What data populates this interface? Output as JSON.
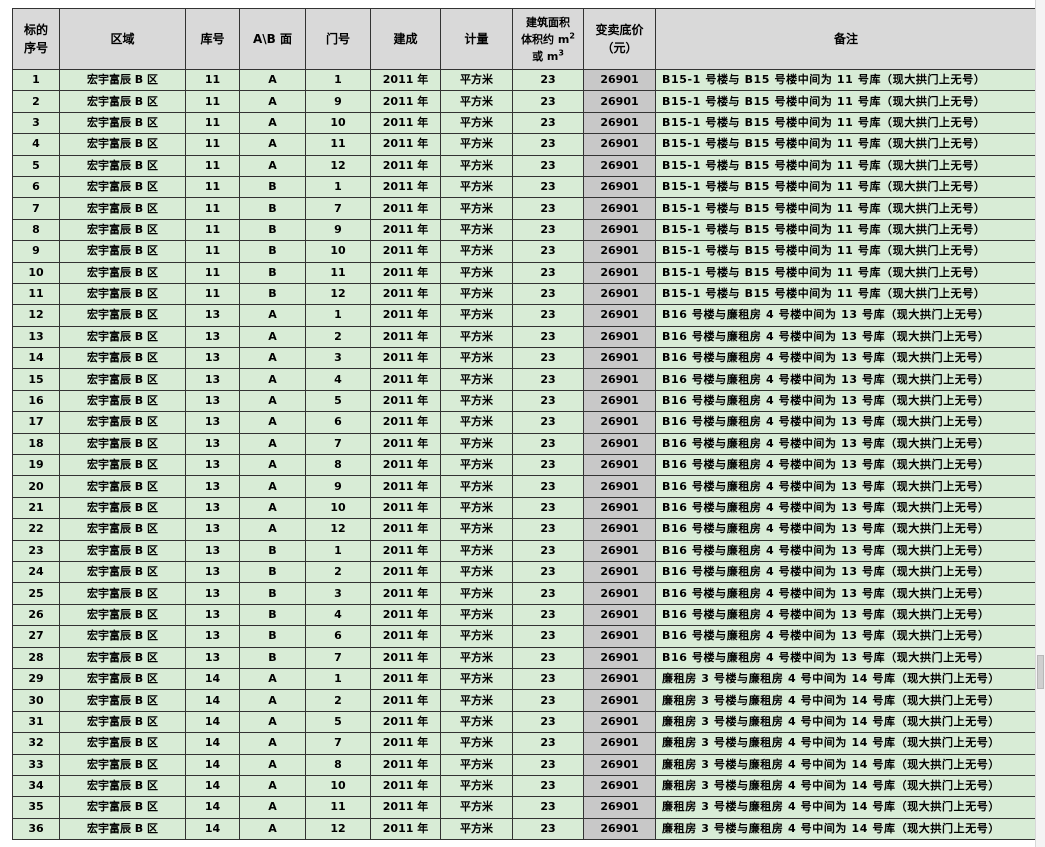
{
  "columns": {
    "seq_line1": "标的",
    "seq_line2": "序号",
    "area": "区域",
    "lot": "库号",
    "side": "A\\B 面",
    "door": "门号",
    "built": "建成",
    "unit": "计量",
    "size_line1": "建筑面积",
    "size_line2": "体积约 m",
    "size_sup1": "2",
    "size_line3": "或 m",
    "size_sup2": "3",
    "price_line1": "变卖底价",
    "price_line2": "（元）",
    "note": "备注"
  },
  "rows": [
    {
      "seq": "1",
      "area": "宏宇富辰 B 区",
      "lot": "11",
      "side": "A",
      "door": "1",
      "built": "2011 年",
      "unit": "平方米",
      "size": "23",
      "price": "26901",
      "note": "B15-1 号楼与 B15 号楼中间为 11 号库（现大拱门上无号）"
    },
    {
      "seq": "2",
      "area": "宏宇富辰 B 区",
      "lot": "11",
      "side": "A",
      "door": "9",
      "built": "2011 年",
      "unit": "平方米",
      "size": "23",
      "price": "26901",
      "note": "B15-1 号楼与 B15 号楼中间为 11 号库（现大拱门上无号）"
    },
    {
      "seq": "3",
      "area": "宏宇富辰 B 区",
      "lot": "11",
      "side": "A",
      "door": "10",
      "built": "2011 年",
      "unit": "平方米",
      "size": "23",
      "price": "26901",
      "note": "B15-1 号楼与 B15 号楼中间为 11 号库（现大拱门上无号）"
    },
    {
      "seq": "4",
      "area": "宏宇富辰 B 区",
      "lot": "11",
      "side": "A",
      "door": "11",
      "built": "2011 年",
      "unit": "平方米",
      "size": "23",
      "price": "26901",
      "note": "B15-1 号楼与 B15 号楼中间为 11 号库（现大拱门上无号）"
    },
    {
      "seq": "5",
      "area": "宏宇富辰 B 区",
      "lot": "11",
      "side": "A",
      "door": "12",
      "built": "2011 年",
      "unit": "平方米",
      "size": "23",
      "price": "26901",
      "note": "B15-1 号楼与 B15 号楼中间为 11 号库（现大拱门上无号）"
    },
    {
      "seq": "6",
      "area": "宏宇富辰 B 区",
      "lot": "11",
      "side": "B",
      "door": "1",
      "built": "2011 年",
      "unit": "平方米",
      "size": "23",
      "price": "26901",
      "note": "B15-1 号楼与 B15 号楼中间为 11 号库（现大拱门上无号）"
    },
    {
      "seq": "7",
      "area": "宏宇富辰 B 区",
      "lot": "11",
      "side": "B",
      "door": "7",
      "built": "2011 年",
      "unit": "平方米",
      "size": "23",
      "price": "26901",
      "note": "B15-1 号楼与 B15 号楼中间为 11 号库（现大拱门上无号）"
    },
    {
      "seq": "8",
      "area": "宏宇富辰 B 区",
      "lot": "11",
      "side": "B",
      "door": "9",
      "built": "2011 年",
      "unit": "平方米",
      "size": "23",
      "price": "26901",
      "note": "B15-1 号楼与 B15 号楼中间为 11 号库（现大拱门上无号）"
    },
    {
      "seq": "9",
      "area": "宏宇富辰 B 区",
      "lot": "11",
      "side": "B",
      "door": "10",
      "built": "2011 年",
      "unit": "平方米",
      "size": "23",
      "price": "26901",
      "note": "B15-1 号楼与 B15 号楼中间为 11 号库（现大拱门上无号）"
    },
    {
      "seq": "10",
      "area": "宏宇富辰 B 区",
      "lot": "11",
      "side": "B",
      "door": "11",
      "built": "2011 年",
      "unit": "平方米",
      "size": "23",
      "price": "26901",
      "note": "B15-1 号楼与 B15 号楼中间为 11 号库（现大拱门上无号）"
    },
    {
      "seq": "11",
      "area": "宏宇富辰 B 区",
      "lot": "11",
      "side": "B",
      "door": "12",
      "built": "2011 年",
      "unit": "平方米",
      "size": "23",
      "price": "26901",
      "note": "B15-1 号楼与 B15 号楼中间为 11 号库（现大拱门上无号）"
    },
    {
      "seq": "12",
      "area": "宏宇富辰 B 区",
      "lot": "13",
      "side": "A",
      "door": "1",
      "built": "2011 年",
      "unit": "平方米",
      "size": "23",
      "price": "26901",
      "note": "B16 号楼与廉租房 4 号楼中间为 13 号库（现大拱门上无号）"
    },
    {
      "seq": "13",
      "area": "宏宇富辰 B 区",
      "lot": "13",
      "side": "A",
      "door": "2",
      "built": "2011 年",
      "unit": "平方米",
      "size": "23",
      "price": "26901",
      "note": "B16 号楼与廉租房 4 号楼中间为 13 号库（现大拱门上无号）"
    },
    {
      "seq": "14",
      "area": "宏宇富辰 B 区",
      "lot": "13",
      "side": "A",
      "door": "3",
      "built": "2011 年",
      "unit": "平方米",
      "size": "23",
      "price": "26901",
      "note": "B16 号楼与廉租房 4 号楼中间为 13 号库（现大拱门上无号）"
    },
    {
      "seq": "15",
      "area": "宏宇富辰 B 区",
      "lot": "13",
      "side": "A",
      "door": "4",
      "built": "2011 年",
      "unit": "平方米",
      "size": "23",
      "price": "26901",
      "note": "B16 号楼与廉租房 4 号楼中间为 13 号库（现大拱门上无号）"
    },
    {
      "seq": "16",
      "area": "宏宇富辰 B 区",
      "lot": "13",
      "side": "A",
      "door": "5",
      "built": "2011 年",
      "unit": "平方米",
      "size": "23",
      "price": "26901",
      "note": "B16 号楼与廉租房 4 号楼中间为 13 号库（现大拱门上无号）"
    },
    {
      "seq": "17",
      "area": "宏宇富辰 B 区",
      "lot": "13",
      "side": "A",
      "door": "6",
      "built": "2011 年",
      "unit": "平方米",
      "size": "23",
      "price": "26901",
      "note": "B16 号楼与廉租房 4 号楼中间为 13 号库（现大拱门上无号）"
    },
    {
      "seq": "18",
      "area": "宏宇富辰 B 区",
      "lot": "13",
      "side": "A",
      "door": "7",
      "built": "2011 年",
      "unit": "平方米",
      "size": "23",
      "price": "26901",
      "note": "B16 号楼与廉租房 4 号楼中间为 13 号库（现大拱门上无号）"
    },
    {
      "seq": "19",
      "area": "宏宇富辰 B 区",
      "lot": "13",
      "side": "A",
      "door": "8",
      "built": "2011 年",
      "unit": "平方米",
      "size": "23",
      "price": "26901",
      "note": "B16 号楼与廉租房 4 号楼中间为 13 号库（现大拱门上无号）"
    },
    {
      "seq": "20",
      "area": "宏宇富辰 B 区",
      "lot": "13",
      "side": "A",
      "door": "9",
      "built": "2011 年",
      "unit": "平方米",
      "size": "23",
      "price": "26901",
      "note": "B16 号楼与廉租房 4 号楼中间为 13 号库（现大拱门上无号）"
    },
    {
      "seq": "21",
      "area": "宏宇富辰 B 区",
      "lot": "13",
      "side": "A",
      "door": "10",
      "built": "2011 年",
      "unit": "平方米",
      "size": "23",
      "price": "26901",
      "note": "B16 号楼与廉租房 4 号楼中间为 13 号库（现大拱门上无号）"
    },
    {
      "seq": "22",
      "area": "宏宇富辰 B 区",
      "lot": "13",
      "side": "A",
      "door": "12",
      "built": "2011 年",
      "unit": "平方米",
      "size": "23",
      "price": "26901",
      "note": "B16 号楼与廉租房 4 号楼中间为 13 号库（现大拱门上无号）"
    },
    {
      "seq": "23",
      "area": "宏宇富辰 B 区",
      "lot": "13",
      "side": "B",
      "door": "1",
      "built": "2011 年",
      "unit": "平方米",
      "size": "23",
      "price": "26901",
      "note": "B16 号楼与廉租房 4 号楼中间为 13 号库（现大拱门上无号）"
    },
    {
      "seq": "24",
      "area": "宏宇富辰 B 区",
      "lot": "13",
      "side": "B",
      "door": "2",
      "built": "2011 年",
      "unit": "平方米",
      "size": "23",
      "price": "26901",
      "note": "B16 号楼与廉租房 4 号楼中间为 13 号库（现大拱门上无号）"
    },
    {
      "seq": "25",
      "area": "宏宇富辰 B 区",
      "lot": "13",
      "side": "B",
      "door": "3",
      "built": "2011 年",
      "unit": "平方米",
      "size": "23",
      "price": "26901",
      "note": "B16 号楼与廉租房 4 号楼中间为 13 号库（现大拱门上无号）"
    },
    {
      "seq": "26",
      "area": "宏宇富辰 B 区",
      "lot": "13",
      "side": "B",
      "door": "4",
      "built": "2011 年",
      "unit": "平方米",
      "size": "23",
      "price": "26901",
      "note": "B16 号楼与廉租房 4 号楼中间为 13 号库（现大拱门上无号）"
    },
    {
      "seq": "27",
      "area": "宏宇富辰 B 区",
      "lot": "13",
      "side": "B",
      "door": "6",
      "built": "2011 年",
      "unit": "平方米",
      "size": "23",
      "price": "26901",
      "note": "B16 号楼与廉租房 4 号楼中间为 13 号库（现大拱门上无号）"
    },
    {
      "seq": "28",
      "area": "宏宇富辰 B 区",
      "lot": "13",
      "side": "B",
      "door": "7",
      "built": "2011 年",
      "unit": "平方米",
      "size": "23",
      "price": "26901",
      "note": "B16 号楼与廉租房 4 号楼中间为 13 号库（现大拱门上无号）"
    },
    {
      "seq": "29",
      "area": "宏宇富辰 B 区",
      "lot": "14",
      "side": "A",
      "door": "1",
      "built": "2011 年",
      "unit": "平方米",
      "size": "23",
      "price": "26901",
      "note": "廉租房 3 号楼与廉租房 4 号中间为 14 号库（现大拱门上无号）"
    },
    {
      "seq": "30",
      "area": "宏宇富辰 B 区",
      "lot": "14",
      "side": "A",
      "door": "2",
      "built": "2011 年",
      "unit": "平方米",
      "size": "23",
      "price": "26901",
      "note": "廉租房 3 号楼与廉租房 4 号中间为 14 号库（现大拱门上无号）"
    },
    {
      "seq": "31",
      "area": "宏宇富辰 B 区",
      "lot": "14",
      "side": "A",
      "door": "5",
      "built": "2011 年",
      "unit": "平方米",
      "size": "23",
      "price": "26901",
      "note": "廉租房 3 号楼与廉租房 4 号中间为 14 号库（现大拱门上无号）"
    },
    {
      "seq": "32",
      "area": "宏宇富辰 B 区",
      "lot": "14",
      "side": "A",
      "door": "7",
      "built": "2011 年",
      "unit": "平方米",
      "size": "23",
      "price": "26901",
      "note": "廉租房 3 号楼与廉租房 4 号中间为 14 号库（现大拱门上无号）"
    },
    {
      "seq": "33",
      "area": "宏宇富辰 B 区",
      "lot": "14",
      "side": "A",
      "door": "8",
      "built": "2011 年",
      "unit": "平方米",
      "size": "23",
      "price": "26901",
      "note": "廉租房 3 号楼与廉租房 4 号中间为 14 号库（现大拱门上无号）"
    },
    {
      "seq": "34",
      "area": "宏宇富辰 B 区",
      "lot": "14",
      "side": "A",
      "door": "10",
      "built": "2011 年",
      "unit": "平方米",
      "size": "23",
      "price": "26901",
      "note": "廉租房 3 号楼与廉租房 4 号中间为 14 号库（现大拱门上无号）"
    },
    {
      "seq": "35",
      "area": "宏宇富辰 B 区",
      "lot": "14",
      "side": "A",
      "door": "11",
      "built": "2011 年",
      "unit": "平方米",
      "size": "23",
      "price": "26901",
      "note": "廉租房 3 号楼与廉租房 4 号中间为 14 号库（现大拱门上无号）"
    },
    {
      "seq": "36",
      "area": "宏宇富辰 B 区",
      "lot": "14",
      "side": "A",
      "door": "12",
      "built": "2011 年",
      "unit": "平方米",
      "size": "23",
      "price": "26901",
      "note": "廉租房 3 号楼与廉租房 4 号中间为 14 号库（现大拱门上无号）"
    }
  ]
}
